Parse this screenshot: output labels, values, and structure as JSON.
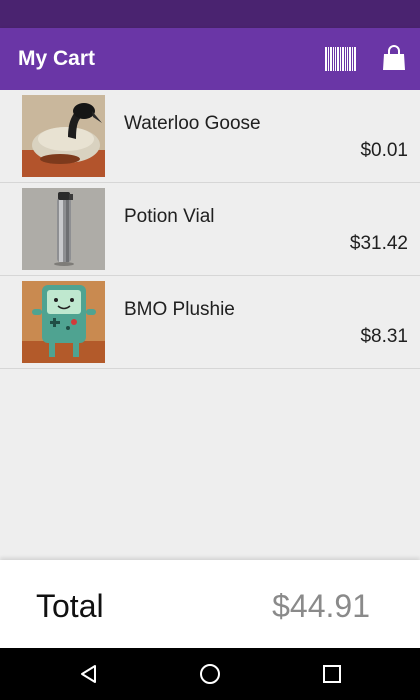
{
  "app": {
    "title": "My Cart"
  },
  "toolbar": {
    "scan_icon": "barcode-icon",
    "checkout_icon": "shopping-bag-icon"
  },
  "cart": {
    "items": [
      {
        "name": "Waterloo Goose",
        "price": "$0.01",
        "image": "goose-plush-photo"
      },
      {
        "name": "Potion Vial",
        "price": "$31.42",
        "image": "steel-bottle-photo"
      },
      {
        "name": "BMO Plushie",
        "price": "$8.31",
        "image": "bmo-plush-photo"
      }
    ]
  },
  "summary": {
    "total_label": "Total",
    "total_value": "$44.91"
  },
  "navigation": {
    "back_icon": "back-triangle-icon",
    "home_icon": "home-circle-icon",
    "recents_icon": "recents-square-icon"
  },
  "colors": {
    "status_bar": "#4a2370",
    "app_bar": "#6a36a6",
    "background": "#eeeeee",
    "total_value": "#8a8a8a"
  }
}
